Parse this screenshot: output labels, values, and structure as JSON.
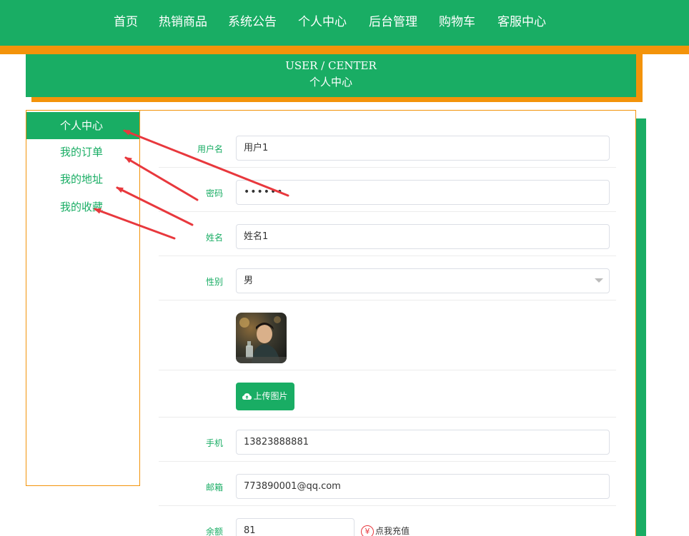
{
  "nav": {
    "items": [
      {
        "label": "首页",
        "key": "home"
      },
      {
        "label": "热销商品",
        "key": "hot"
      },
      {
        "label": "系统公告",
        "key": "notice"
      },
      {
        "label": "个人中心",
        "key": "center"
      },
      {
        "label": "后台管理",
        "key": "admin"
      },
      {
        "label": "购物车",
        "key": "cart"
      },
      {
        "label": "客服中心",
        "key": "service"
      }
    ]
  },
  "header": {
    "en": "USER / CENTER",
    "cn": "个人中心"
  },
  "sidebar": {
    "items": [
      {
        "label": "个人中心",
        "active": true
      },
      {
        "label": "我的订单",
        "active": false
      },
      {
        "label": "我的地址",
        "active": false
      },
      {
        "label": "我的收藏",
        "active": false
      }
    ]
  },
  "form": {
    "username": {
      "label": "用户名",
      "value": "用户1"
    },
    "password": {
      "label": "密码",
      "value": "••••••"
    },
    "name": {
      "label": "姓名",
      "value": "姓名1"
    },
    "gender": {
      "label": "性别",
      "value": "男"
    },
    "upload_label": "上传图片",
    "phone": {
      "label": "手机",
      "value": "13823888881"
    },
    "email": {
      "label": "邮箱",
      "value": "773890001@qq.com"
    },
    "balance": {
      "label": "余额",
      "value": "81"
    },
    "recharge_label": "点我充值",
    "recharge_icon": "¥"
  },
  "colors": {
    "primary": "#19ad64",
    "accent": "#f3930a",
    "annotation": "#e8383d"
  },
  "icons": {
    "upload": "cloud-upload-icon",
    "recharge": "yen-circle-icon",
    "select": "chevron-down-icon"
  }
}
